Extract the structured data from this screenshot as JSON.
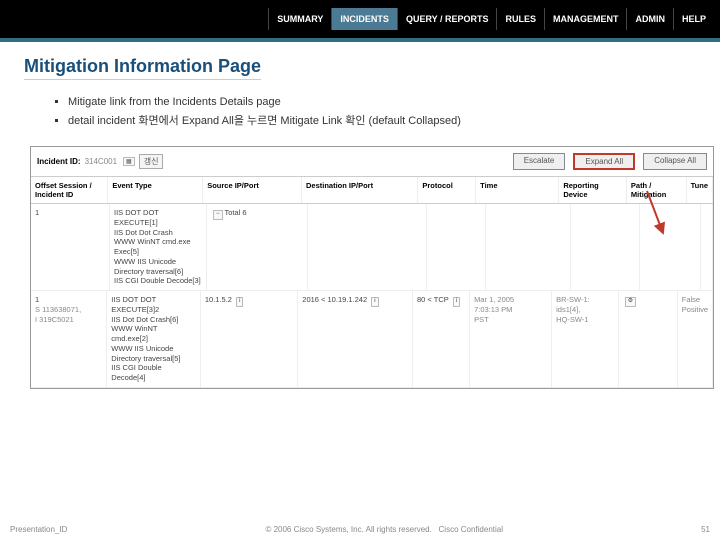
{
  "nav": {
    "items": [
      "SUMMARY",
      "INCIDENTS",
      "QUERY / REPORTS",
      "RULES",
      "MANAGEMENT",
      "ADMIN",
      "HELP"
    ],
    "active": 1
  },
  "title": "Mitigation Information Page",
  "bullets": [
    "Mitigate link from the Incidents Details page",
    "detail incident 화면에서 Expand All을 누르면 Mitigate Link 확인   (default  Collapsed)"
  ],
  "shot": {
    "incident_label": "Incident ID:",
    "incident_id": "314C001",
    "refresh": "갱신",
    "buttons": {
      "escalate": "Escalate",
      "expand": "Expand All",
      "collapse": "Collapse All"
    },
    "headers": [
      "Offset Session / Incident ID",
      "Event Type",
      "Source IP/Port",
      "Destination IP/Port",
      "Protocol",
      "Time",
      "Reporting Device",
      "Path / Mitigation",
      "Tune"
    ],
    "rows": [
      {
        "id": "1",
        "ev": "IIS DOT DOT EXECUTE[1]\nIIS Dot Dot Crash\nWWW WinNT cmd.exe\nExec[5]\nWWW IIS Unicode Directory traversal[6]\nIIS CGI Double Decode[3]",
        "src": "",
        "srcBadge": "Total 6",
        "dst": "",
        "proto": "",
        "time": "",
        "dev": "",
        "mit": "",
        "tune": ""
      },
      {
        "id": "1",
        "sub": "S 113638071,\nI 319C5021",
        "ev": "IIS DOT DOT EXECUTE[3]2\nIIS Dot Dot Crash[6]\nWWW WinNT cmd.exe[2]\nWWW IIS Unicode Directory traversal[5]\nIIS CGI Double Decode[4]",
        "src": "10.1.5.2",
        "dst": "2016 < 10.19.1.242",
        "proto": "80 < TCP",
        "time": "Mar 1, 2005\n7:03:13 PM\nPST",
        "dev": "BR-SW-1:\nids1[4],\nHQ-SW-1",
        "mit": "icon",
        "tune": "False Positive"
      }
    ]
  },
  "footer": {
    "left": "Presentation_ID",
    "mid": "© 2006 Cisco Systems, Inc. All rights reserved.",
    "mid2": "Cisco Confidential",
    "page": "51"
  }
}
